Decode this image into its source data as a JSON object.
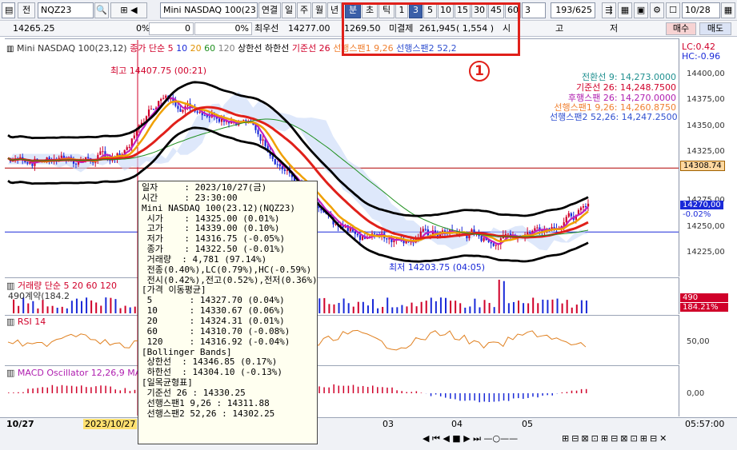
{
  "toolbar": {
    "jeon": "전",
    "symbol": "NQZ23",
    "name": "Mini NASDAQ 100(23.1",
    "periods": [
      "연결",
      "일",
      "주",
      "월",
      "년",
      "분",
      "초",
      "틱"
    ],
    "numbers": [
      "1",
      "3",
      "5",
      "10",
      "15",
      "30",
      "45",
      "60"
    ],
    "count": "3",
    "range": "193/625",
    "date": "10/28",
    "selected_period": "분",
    "selected_number": "3"
  },
  "quote": {
    "price": "14265.25",
    "pct": "0%",
    "chg": "0",
    "chg_pct": "0%",
    "best_label": "최우선",
    "best_val": "14277.00",
    "best_val2": "1269.50",
    "open_int_label": "미결제",
    "open_int": "261,945",
    "open_int_chg": "( 1,554 )",
    "si": "시",
    "go": "고",
    "jeo": "저",
    "buy": "매수",
    "sell": "매도"
  },
  "main_pane": {
    "legend": [
      "Mini NASDAQ 100(23,12)",
      "종가 단순 5",
      "10",
      "20",
      "60",
      "120",
      "상한선",
      "하한선",
      "기준선 26",
      "선행스팬1 9,26",
      "선행스팬2 52,2"
    ],
    "high_label": "최고 14407.75 (00:21)",
    "low_label": "최저 14203.75 (04:05)",
    "lc": "LC:0.42",
    "hc": "HC:-0.96",
    "ichimoku": [
      "전환선 9: 14,273.0000",
      "기준선 26: 14,248.7500",
      "후행스팬 26: 14,270.0000",
      "선행스팬1 9,26: 14,260.8750",
      "선행스팬2 52,26: 14,247.2500"
    ],
    "ticks": [
      "14400,00",
      "14375,00",
      "14350,00",
      "14325,00",
      "14275,00",
      "14250,00",
      "14225,00"
    ],
    "tag1": "14308.74",
    "tag2": "14270,00",
    "tag2_pct": "-0.02%"
  },
  "volume_pane": {
    "legend": "거래량 단순 5 20 60 120",
    "sub": "490계약(184.2",
    "tag": "490",
    "tag_pct": "184.21%"
  },
  "rsi_pane": {
    "legend": "RSI 14",
    "tick": "50,00"
  },
  "macd_pane": {
    "legend": "MACD Oscillator 12,26,9 MA",
    "tick": "0,00"
  },
  "xaxis": {
    "left": "10/27",
    "date_box": "2023/10/27",
    "labels": [
      "03",
      "04",
      "05"
    ],
    "time": "05:57:00"
  },
  "tooltip": {
    "lines": [
      "일자     : 2023/10/27(금)",
      "시간     : 23:30:00",
      "Mini NASDAQ 100(23.12)(NQZ23)",
      " 시가    : 14325.00 (0.01%)",
      " 고가    : 14339.00 (0.10%)",
      " 저가    : 14316.75 (-0.05%)",
      " 종가    : 14322.50 (-0.01%)",
      " 거래량  : 4,781 (97.14%)",
      " 전종(0.40%),LC(0.79%),HC(-0.59%)",
      " 전시(0.42%),전고(0.52%),전저(0.36%)",
      "[가격 이동평균]",
      " 5       : 14327.70 (0.04%)",
      " 10      : 14330.67 (0.06%)",
      " 20      : 14324.31 (0.01%)",
      " 60      : 14310.70 (-0.08%)",
      " 120     : 14316.92 (-0.04%)",
      "[Bollinger Bands]",
      " 상한선  : 14346.85 (0.17%)",
      " 하한선  : 14304.10 (-0.13%)",
      "[일목균형표]",
      " 기준선 26 : 14330.25",
      " 선행스팬1 9,26 : 14311.88",
      " 선행스팬2 52,26 : 14302.25"
    ]
  },
  "annotation": "1",
  "colors": {
    "red": "#e0201a",
    "blue_candle": "#1a2ad8",
    "orange": "#f0a000",
    "purple": "#c020c0"
  }
}
